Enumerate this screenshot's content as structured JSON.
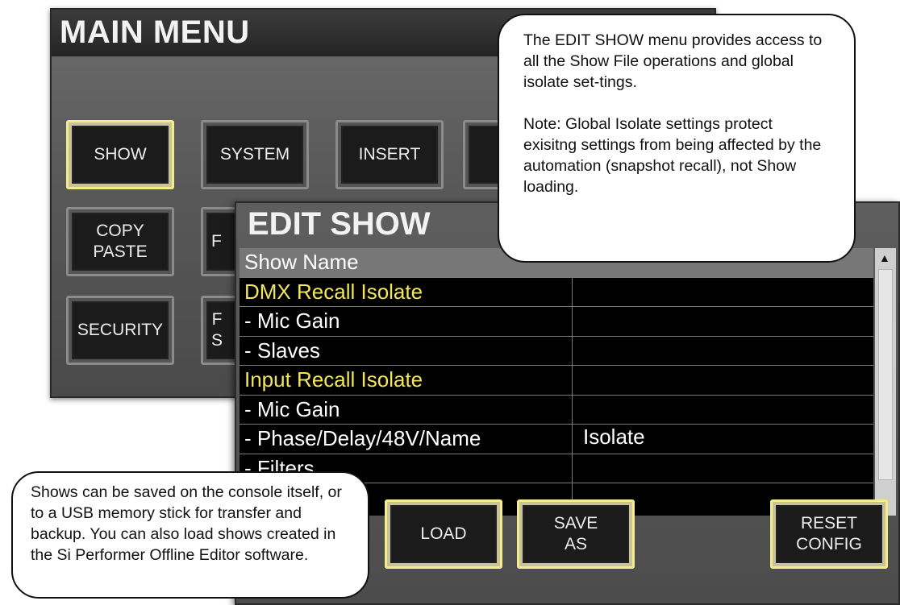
{
  "main_menu": {
    "title": "MAIN MENU",
    "buttons": [
      {
        "label": "SHOW",
        "selected": true
      },
      {
        "label": "SYSTEM",
        "selected": false
      },
      {
        "label": "INSERT",
        "selected": false
      },
      {
        "label": "COPY\nPASTE",
        "selected": false
      },
      {
        "label": "F",
        "selected": false
      },
      {
        "label": "SECURITY",
        "selected": false
      },
      {
        "label": "F\nS",
        "selected": false
      }
    ]
  },
  "edit_show": {
    "title": "EDIT SHOW",
    "rows": [
      {
        "label": "Show Name",
        "value": "",
        "type": "selected"
      },
      {
        "label": "DMX Recall Isolate",
        "value": "",
        "type": "section"
      },
      {
        "label": "- Mic Gain",
        "value": "",
        "type": "item"
      },
      {
        "label": "- Slaves",
        "value": "",
        "type": "item"
      },
      {
        "label": "Input Recall Isolate",
        "value": "",
        "type": "section"
      },
      {
        "label": "- Mic Gain",
        "value": "",
        "type": "item"
      },
      {
        "label": "- Phase/Delay/48V/Name",
        "value": "Isolate",
        "type": "item"
      },
      {
        "label": "- Filters",
        "value": "",
        "type": "item"
      }
    ],
    "buttons": {
      "load": "LOAD",
      "save_as": "SAVE\nAS",
      "reset_config": "RESET\nCONFIG"
    }
  },
  "callouts": {
    "top_p1": "The EDIT SHOW menu provides access to all the Show File operations and global isolate set-tings.",
    "top_p2": "Note: Global Isolate settings protect exisitng settings from being affected by the automation (snapshot recall), not Show loading.",
    "bottom": "Shows can be saved on the console itself, or to a USB memory stick for transfer and backup. You can also load shows created in the Si Performer Offline Editor software."
  },
  "colors": {
    "section_text": "#f4e65a",
    "selected_border": "#f4ec8a",
    "panel_bg": "#5a5a5a"
  }
}
